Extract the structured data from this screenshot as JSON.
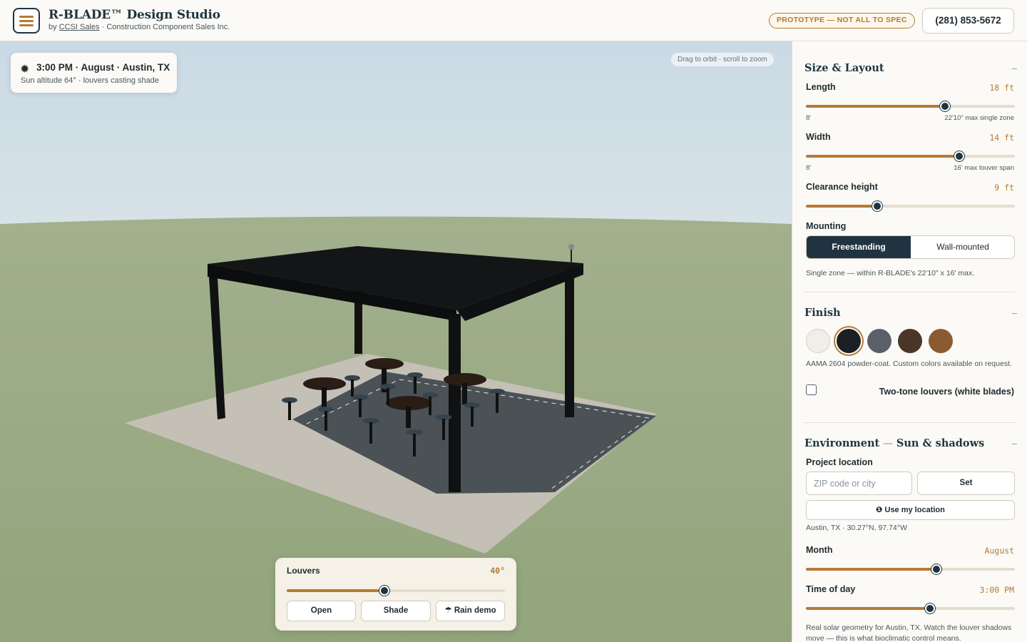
{
  "header": {
    "title": "R-BLADE™ Design Studio",
    "subtitle_by": "by",
    "subtitle_link": "CCSI Sales",
    "subtitle_rest": " · Construction Component Sales Inc.",
    "badge": "PROTOTYPE — NOT ALL TO SPEC",
    "phone": "(281) 853-5672"
  },
  "viewport": {
    "sun_card": {
      "line1": "3:00 PM · August · Austin, TX",
      "line2": "Sun altitude 64° · louvers casting shade"
    },
    "hint": "Drag to orbit · scroll to zoom",
    "louvers": {
      "label": "Louvers",
      "value": "40°",
      "slider_fraction": 0.449,
      "buttons": [
        "Open",
        "Shade",
        "☂ Rain demo"
      ]
    }
  },
  "sidebar": {
    "size_layout": {
      "title": "Size & Layout",
      "toggle": "–",
      "length": {
        "label": "Length",
        "value": "18 ft",
        "min": "8'",
        "max": "22'10\" max single zone",
        "fraction": 0.667
      },
      "width": {
        "label": "Width",
        "value": "14 ft",
        "min": "8'",
        "max": "16' max louver span",
        "fraction": 0.735
      },
      "clearance": {
        "label": "Clearance height",
        "value": "9 ft",
        "fraction": 0.34
      },
      "mounting": {
        "label": "Mounting",
        "options": [
          "Freestanding",
          "Wall-mounted"
        ],
        "selected": "Freestanding"
      },
      "note": "Single zone — within R-BLADE's 22'10\" x 16' max."
    },
    "finish": {
      "title": "Finish",
      "toggle": "–",
      "swatches": [
        "#f0eee8",
        "#1c2024",
        "#5a6068",
        "#4a3526",
        "#8a5a30"
      ],
      "selected_index": 1,
      "note": "AAMA 2604 powder-coat. Custom colors available on request.",
      "two_tone_label": "Two-tone louvers (white blades)",
      "two_tone_checked": false
    },
    "environment": {
      "title_a": "Environment",
      "title_dash": " — ",
      "title_b": "Sun & shadows",
      "toggle": "–",
      "location_label": "Project location",
      "location_placeholder": "ZIP code or city",
      "set_button": "Set",
      "use_location_button": "❶ Use my location",
      "location_text": "Austin, TX · 30.27°N, 97.74°W",
      "month": {
        "label": "Month",
        "value": "August",
        "fraction": 0.626
      },
      "time": {
        "label": "Time of day",
        "value": "3:00 PM",
        "fraction": 0.595
      },
      "note": "Real solar geometry for Austin, TX. Watch the louver shadows move — this is what bioclimatic control means."
    }
  },
  "colors": {
    "accent": "#b57a36",
    "navy": "#1f3440",
    "sky": "#cddde6",
    "grass": "#9aab84"
  }
}
